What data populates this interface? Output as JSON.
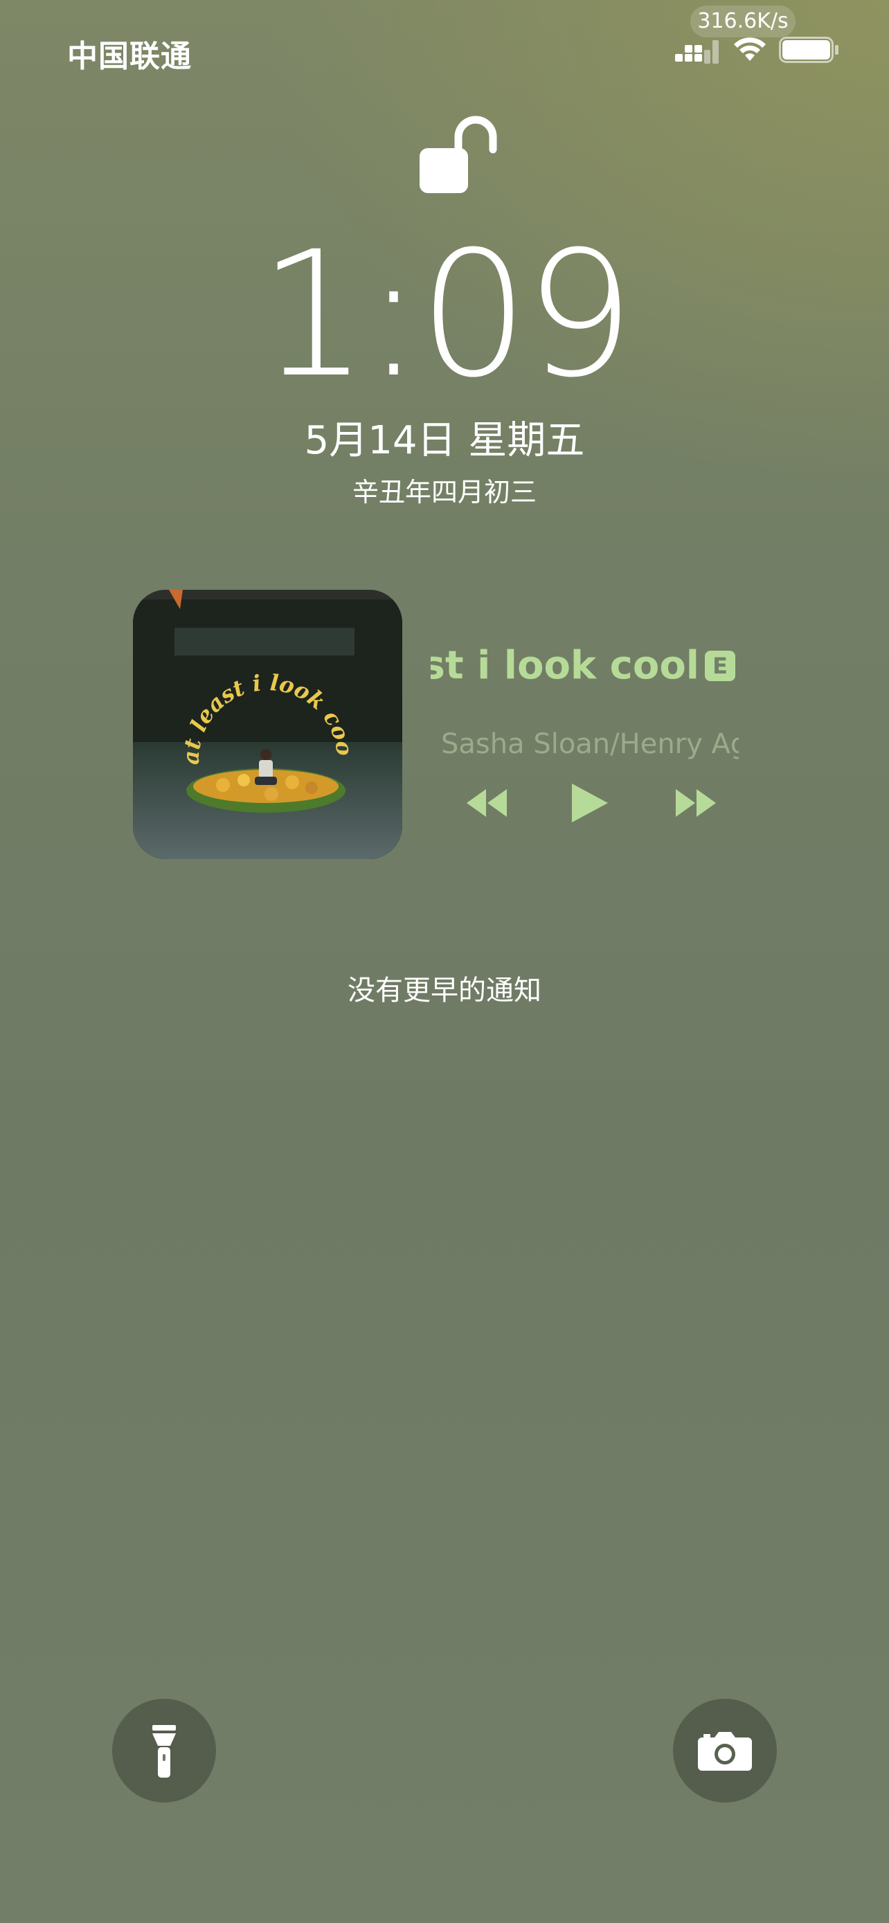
{
  "status_bar": {
    "carrier": "中国联通",
    "net_speed": "316.6K/s"
  },
  "lock_screen": {
    "time": "1:09",
    "date": "5月14日 星期五",
    "lunar_date": "辛丑年四月初三"
  },
  "music": {
    "album_text": "at least i look cool",
    "title": "st i look cool",
    "explicit_badge": "E",
    "artist": "Sasha Sloan/Henry Ag",
    "accent_color": "#b6db98"
  },
  "notifications": {
    "empty_text": "没有更早的通知"
  },
  "quick_actions": {
    "left_icon": "flashlight-icon",
    "right_icon": "camera-icon"
  }
}
